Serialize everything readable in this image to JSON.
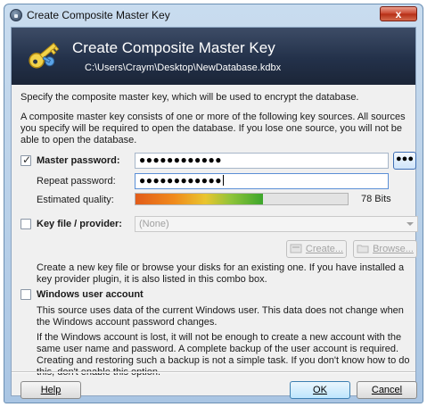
{
  "window": {
    "title": "Create Composite Master Key",
    "close_label": "x"
  },
  "banner": {
    "title": "Create Composite Master Key",
    "path": "C:\\Users\\Craym\\Desktop\\NewDatabase.kdbx"
  },
  "intro": {
    "line1": "Specify the composite master key, which will be used to encrypt the database.",
    "line2": "A composite master key consists of one or more of the following key sources. All sources you specify will be required to open the database.  If you lose one source, you will not be able to open the database."
  },
  "master_password": {
    "label": "Master password:",
    "checked": true,
    "value": "●●●●●●●●●●●●",
    "show_button_label": "●●●",
    "repeat_label": "Repeat password:",
    "repeat_value": "●●●●●●●●●●●●",
    "quality_label": "Estimated quality:",
    "quality_text": "78 Bits",
    "quality_fraction": 0.6
  },
  "key_file": {
    "label": "Key file / provider:",
    "checked": false,
    "selected": "(None)",
    "create_label": "Create...",
    "browse_label": "Browse...",
    "description": "Create a new key file or browse your disks for an existing one. If you have installed a key provider plugin, it is also listed in this combo box."
  },
  "windows_account": {
    "label": "Windows user account",
    "checked": false,
    "description1": "This source uses data of the current Windows user. This data does not change when the Windows account password changes.",
    "description2": "If the Windows account is lost, it will not be enough to create a new account with the same user name and password. A complete backup of the user account is required. Creating and restoring such a backup is not a simple task.  If you don't know how to do this, don't enable this option."
  },
  "buttons": {
    "help": "Help",
    "ok": "OK",
    "cancel": "Cancel"
  },
  "colors": {
    "banner": "#23314a",
    "accent": "#3c7fb1"
  }
}
